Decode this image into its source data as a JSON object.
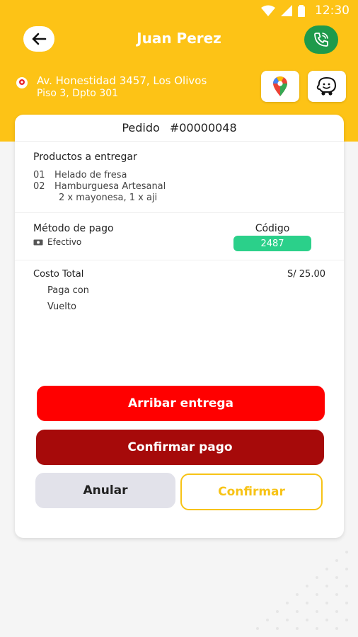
{
  "status_bar": {
    "time": "12:30"
  },
  "header": {
    "title": "Juan Perez",
    "address_line1": "Av. Honestidad 3457, Los Olivos",
    "address_line2": "Piso 3, Dpto 301"
  },
  "icons": {
    "back": "arrow-left-icon",
    "call": "phone-icon",
    "location": "location-pin-icon",
    "maps": "google-maps-icon",
    "waze": "waze-icon",
    "cash": "cash-icon"
  },
  "order": {
    "label": "Pedido",
    "number": "#00000048"
  },
  "products": {
    "title": "Productos a entregar",
    "items": [
      {
        "num": "01",
        "name": "Helado de fresa"
      },
      {
        "num": "02",
        "name": "Hamburguesa Artesanal"
      }
    ],
    "extras": "2 x mayonesa, 1 x aji"
  },
  "payment": {
    "method_label": "Método de pago",
    "method_value": "Efectivo",
    "code_label": "Código",
    "code_value": "2487"
  },
  "totals": {
    "total_label": "Costo Total",
    "total_value": "S/ 25.00",
    "pays_with_label": "Paga con",
    "change_label": "Vuelto"
  },
  "actions": {
    "arribar": "Arribar entrega",
    "confirmar_pago": "Confirmar pago",
    "anular": "Anular",
    "confirmar": "Confirmar"
  },
  "colors": {
    "header_yellow": "#fdc316",
    "call_green": "#1e9a4b",
    "code_green": "#2bd08a",
    "red": "#ff0000",
    "dark_red": "#a60a0a",
    "confirm_yellow": "#f7c316"
  }
}
